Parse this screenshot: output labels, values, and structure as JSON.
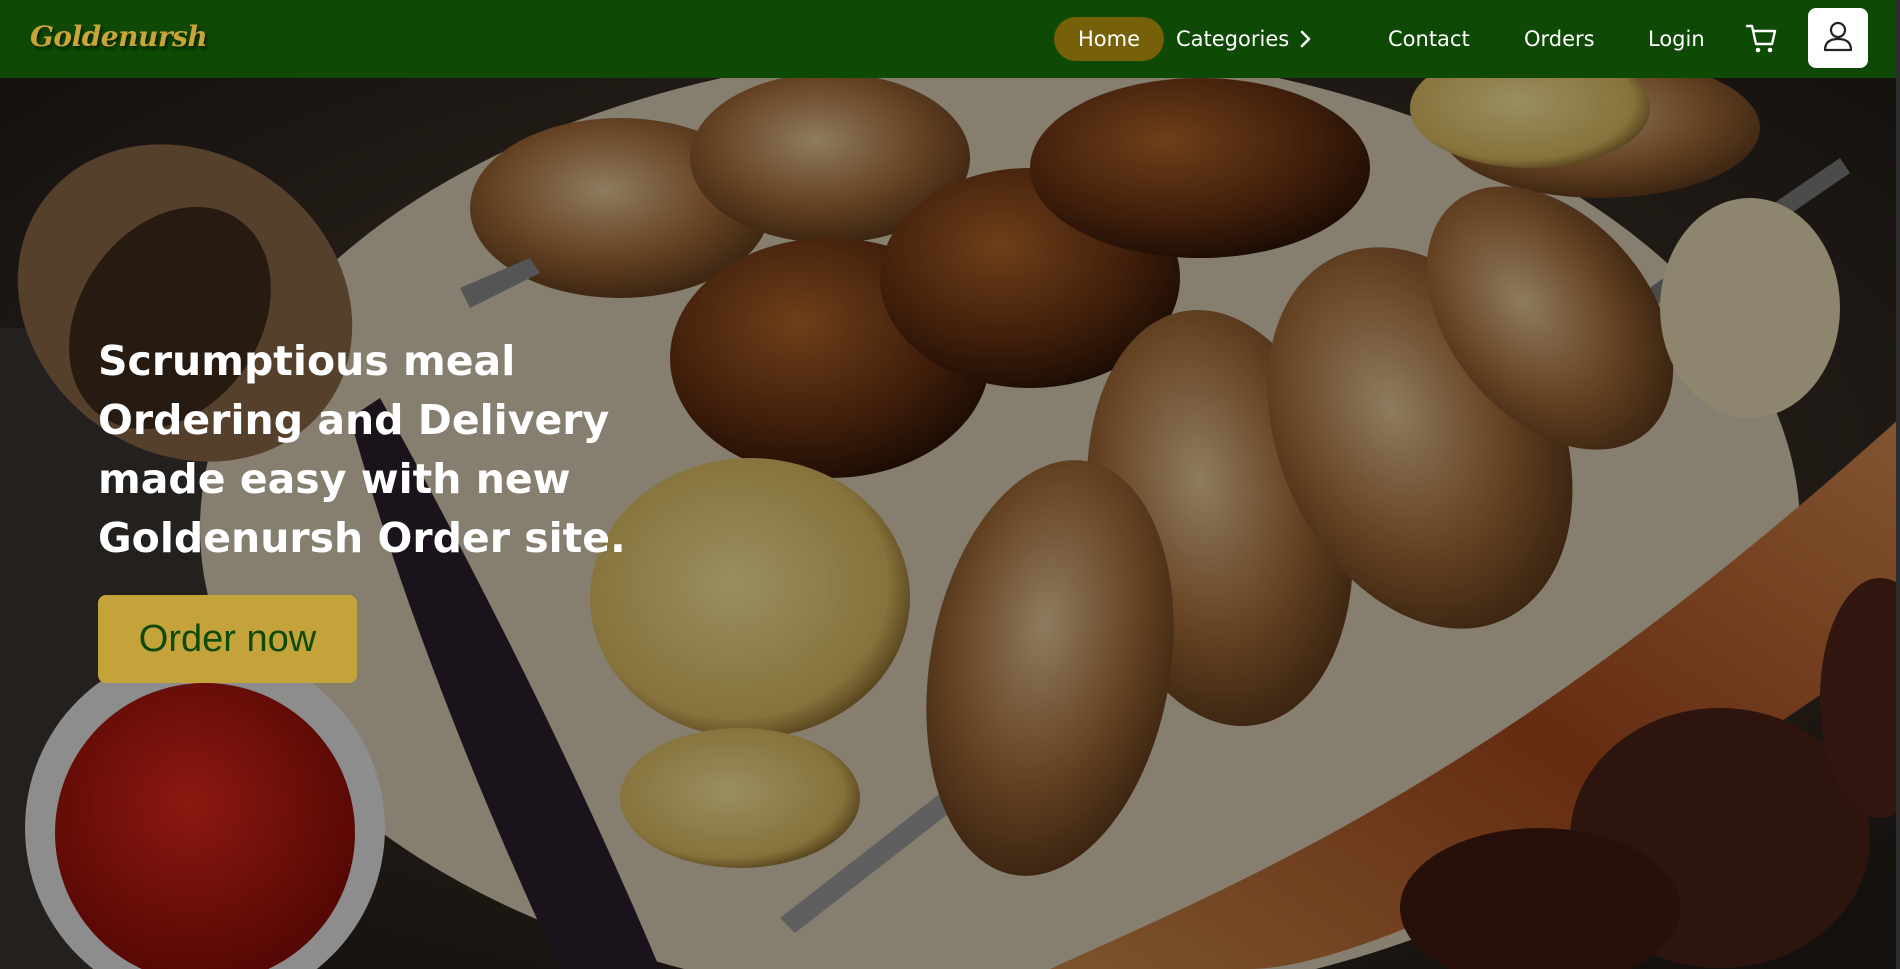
{
  "brand": {
    "logo_text": "Goldenursh"
  },
  "nav": {
    "home": "Home",
    "categories": "Categories",
    "contact": "Contact",
    "orders": "Orders",
    "login": "Login",
    "active": "Home"
  },
  "icons": {
    "cart": "cart-icon",
    "user": "user-icon",
    "categories_chevron": "chevron-right-icon"
  },
  "hero": {
    "heading": "Scrumptious meal Ordering and Delivery made easy with new Goldenursh Order site.",
    "cta_label": "Order now",
    "background_image": "grilled-meat-platter"
  },
  "colors": {
    "nav_bg": "#0e4a05",
    "active_pill": "#76600a",
    "accent_gold": "#c4a33b",
    "cta_text": "#0e4a05"
  }
}
